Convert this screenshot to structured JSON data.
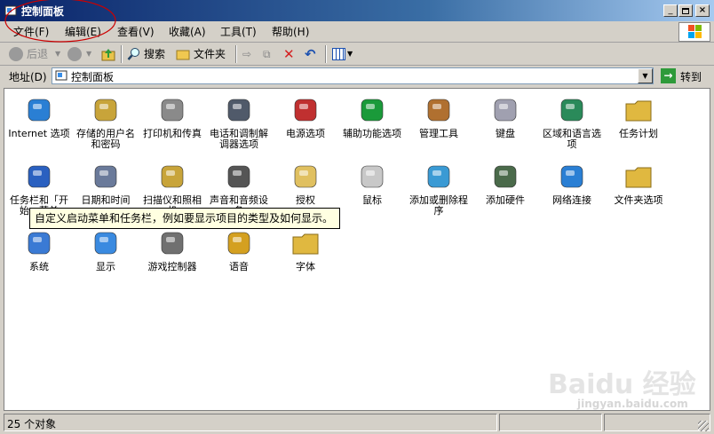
{
  "window": {
    "title": "控制面板"
  },
  "menu": [
    "文件(F)",
    "编辑(E)",
    "查看(V)",
    "收藏(A)",
    "工具(T)",
    "帮助(H)"
  ],
  "toolbar": {
    "back": "后退",
    "search": "搜索",
    "folders": "文件夹"
  },
  "address": {
    "label": "地址(D)",
    "value": "控制面板",
    "go": "转到"
  },
  "items": [
    {
      "label": "Internet 选项",
      "icon": "globe-check-icon"
    },
    {
      "label": "存储的用户名和密码",
      "icon": "keys-icon"
    },
    {
      "label": "打印机和传真",
      "icon": "printer-icon"
    },
    {
      "label": "电话和调制解调器选项",
      "icon": "phone-modem-icon"
    },
    {
      "label": "电源选项",
      "icon": "power-plug-icon"
    },
    {
      "label": "辅助功能选项",
      "icon": "accessibility-icon"
    },
    {
      "label": "管理工具",
      "icon": "admin-tools-icon"
    },
    {
      "label": "键盘",
      "icon": "keyboard-icon"
    },
    {
      "label": "区域和语言选项",
      "icon": "globe-clock-icon"
    },
    {
      "label": "任务计划",
      "icon": "scheduled-tasks-folder-icon"
    },
    {
      "label": "任务栏和「开始」菜单",
      "icon": "taskbar-icon"
    },
    {
      "label": "日期和时间",
      "icon": "clock-icon"
    },
    {
      "label": "扫描仪和照相机",
      "icon": "scanner-camera-icon"
    },
    {
      "label": "声音和音频设备",
      "icon": "speaker-icon"
    },
    {
      "label": "授权",
      "icon": "certificate-icon"
    },
    {
      "label": "鼠标",
      "icon": "mouse-icon"
    },
    {
      "label": "添加或删除程序",
      "icon": "add-remove-programs-icon"
    },
    {
      "label": "添加硬件",
      "icon": "add-hardware-icon"
    },
    {
      "label": "网络连接",
      "icon": "network-globe-icon"
    },
    {
      "label": "文件夹选项",
      "icon": "folder-options-icon"
    },
    {
      "label": "系统",
      "icon": "system-icon"
    },
    {
      "label": "显示",
      "icon": "display-icon"
    },
    {
      "label": "游戏控制器",
      "icon": "game-controller-icon"
    },
    {
      "label": "语音",
      "icon": "speech-icon"
    },
    {
      "label": "字体",
      "icon": "fonts-folder-icon"
    }
  ],
  "tooltip": "自定义启动菜单和任务栏，例如要显示项目的类型及如何显示。",
  "status": {
    "text": "25 个对象"
  },
  "watermark": {
    "brand": "Baidu 经验",
    "url": "jingyan.baidu.com"
  },
  "colors": {
    "titlebar": "#0a246a",
    "annotation": "#cc0000",
    "tooltip_bg": "#ffffe1"
  }
}
